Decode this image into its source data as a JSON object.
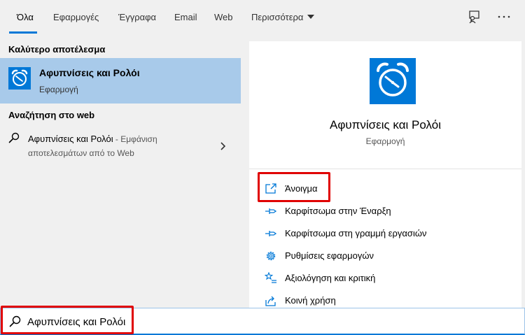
{
  "tabs": [
    {
      "label": "Όλα"
    },
    {
      "label": "Εφαρμογές"
    },
    {
      "label": "Έγγραφα"
    },
    {
      "label": "Email"
    },
    {
      "label": "Web"
    },
    {
      "label": "Περισσότερα"
    }
  ],
  "toolbar": {
    "feedback_icon": "feedback-icon",
    "more_icon": "ellipsis-icon"
  },
  "best_match": {
    "heading": "Καλύτερο αποτέλεσμα",
    "title": "Αφυπνίσεις και Ρολόι",
    "subtitle": "Εφαρμογή",
    "icon": "alarm-clock-icon"
  },
  "web_search": {
    "heading": "Αναζήτηση στο web",
    "query": "Αφυπνίσεις και Ρολόι",
    "suffix": " - Εμφάνιση αποτελεσμάτων από το Web"
  },
  "detail": {
    "title": "Αφυπνίσεις και Ρολόι",
    "subtitle": "Εφαρμογή",
    "actions": [
      {
        "label": "Άνοιγμα",
        "icon": "open-icon"
      },
      {
        "label": "Καρφίτσωμα στην Έναρξη",
        "icon": "pin-icon"
      },
      {
        "label": "Καρφίτσωμα στη γραμμή εργασιών",
        "icon": "pin-icon"
      },
      {
        "label": "Ρυθμίσεις εφαρμογών",
        "icon": "gear-icon"
      },
      {
        "label": "Αξιολόγηση και κριτική",
        "icon": "star-icon"
      },
      {
        "label": "Κοινή χρήση",
        "icon": "share-icon"
      }
    ]
  },
  "search": {
    "value": "Αφυπνίσεις και Ρολόι"
  },
  "colors": {
    "accent": "#0078d7",
    "selection": "#a8caea",
    "highlight": "#e00000"
  }
}
